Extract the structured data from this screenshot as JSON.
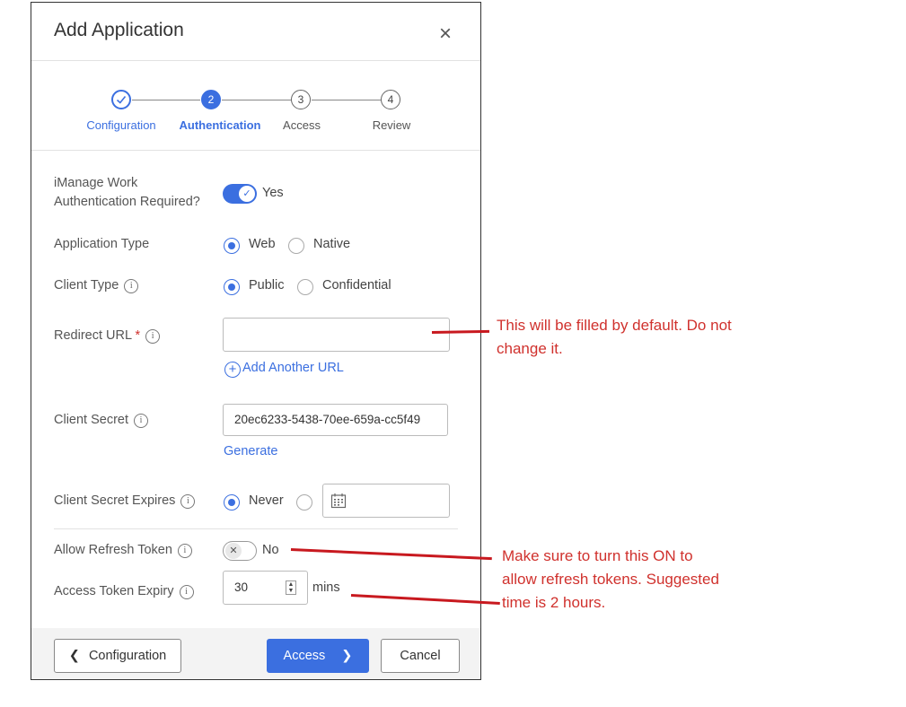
{
  "dialog": {
    "title": "Add Application",
    "close_glyph": "×"
  },
  "stepper": {
    "steps": [
      {
        "label": "Configuration",
        "number": "✓",
        "state": "done"
      },
      {
        "label": "Authentication",
        "number": "2",
        "state": "active"
      },
      {
        "label": "Access",
        "number": "3",
        "state": "todo"
      },
      {
        "label": "Review",
        "number": "4",
        "state": "todo"
      }
    ]
  },
  "form": {
    "auth_required": {
      "label_line1": "iManage Work",
      "label_line2": "Authentication Required?",
      "value_label": "Yes",
      "on": true
    },
    "app_type": {
      "label": "Application Type",
      "options": [
        "Web",
        "Native"
      ],
      "selected": "Web"
    },
    "client_type": {
      "label": "Client Type",
      "options": [
        "Public",
        "Confidential"
      ],
      "selected": "Public"
    },
    "redirect_url": {
      "label": "Redirect URL",
      "required_mark": "*",
      "value": "",
      "add_link": "Add Another URL"
    },
    "client_secret": {
      "label": "Client Secret",
      "value": "20ec6233-5438-70ee-659a-cc5f49",
      "generate_link": "Generate"
    },
    "client_secret_expires": {
      "label": "Client Secret Expires",
      "option_never": "Never",
      "selected": "Never"
    },
    "allow_refresh_token": {
      "label": "Allow Refresh Token",
      "value_label": "No",
      "on": false
    },
    "access_token_expiry": {
      "label": "Access Token Expiry",
      "value": "30",
      "unit": "mins"
    }
  },
  "footer": {
    "back_label": "Configuration",
    "next_label": "Access",
    "cancel_label": "Cancel"
  },
  "annotations": {
    "redirect_note": [
      "This will be filled by default. Do not",
      "change it."
    ],
    "refresh_note": [
      "Make sure to turn this ON to",
      "allow refresh tokens. Suggested",
      "time is 2 hours."
    ]
  },
  "colors": {
    "accent": "#3b6fe0",
    "annotation": "#d0312d"
  }
}
